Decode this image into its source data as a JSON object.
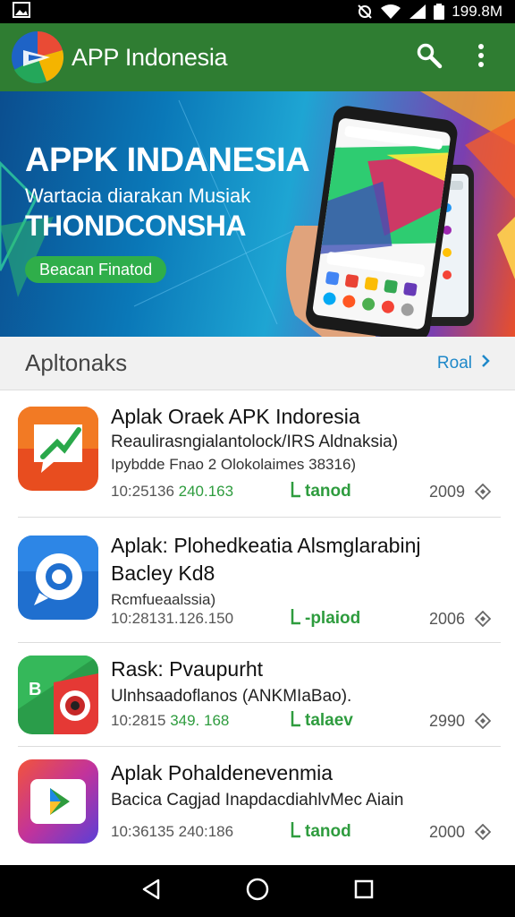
{
  "status_bar": {
    "time": "199.8M"
  },
  "app_bar": {
    "title": "APP Indonesia",
    "icons": [
      "search-icon",
      "more-vert-icon"
    ]
  },
  "banner": {
    "title": "APPK INDANESIA",
    "subtitle": "Wartacia diarakan Musiak",
    "subtitle2": "THONDCONSHA",
    "cta": "Beacan Finatod"
  },
  "section": {
    "title": "Apltonaks",
    "link": "Roal"
  },
  "apps": [
    {
      "title": "Aplak Oraek APK Indoresia",
      "line1": "Reaulirasngialantolock/IRS Aldnaksia)",
      "line2": "Ipybdde Fnao 2 Olokolaimes 38316)",
      "date": "10:25136",
      "date_green": "240.163",
      "download": "tanod",
      "year": "2009",
      "icon_color": "#e84d1f"
    },
    {
      "title": "Aplak: Plohedkeatia Alsmglarabinj",
      "line1": "Bacley Kd8",
      "line2": "Rcmfueaalssia)",
      "date": "10:28131.126.150",
      "date_green": "",
      "download": "-plaiod",
      "year": "2006",
      "icon_color": "#1f6fcf"
    },
    {
      "title": "Rask: Pvaupurht",
      "line1": "Ulnhsaadoflanos (ANKMIaBao).",
      "line2": "",
      "date": "10:2815",
      "date_green": "349. 168",
      "download": "talaev",
      "year": "2990",
      "icon_color": "#2a9d4a"
    },
    {
      "title": "Aplak Pohaldenevenmia",
      "line1": "Bacica Cagjad InapdacdiahlvMec Aiain",
      "line2": "",
      "date": "10:36135 240:186",
      "date_green": "",
      "download": "tanod",
      "year": "2000",
      "icon_color": "#8a3ccf"
    }
  ]
}
